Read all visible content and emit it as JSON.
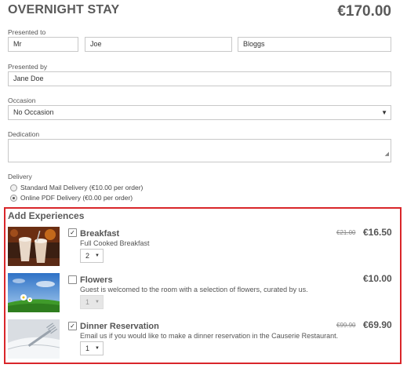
{
  "header": {
    "title": "OVERNIGHT STAY",
    "total": "€170.00"
  },
  "presented_to": {
    "label": "Presented to",
    "title_value": "Mr",
    "first_name": "Joe",
    "last_name": "Bloggs"
  },
  "presented_by": {
    "label": "Presented by",
    "value": "Jane Doe"
  },
  "occasion": {
    "label": "Occasion",
    "value": "No Occasion"
  },
  "dedication": {
    "label": "Dedication",
    "value": ""
  },
  "delivery": {
    "label": "Delivery",
    "options": [
      {
        "label": "Standard Mail Delivery (€10.00 per order)",
        "selected": false
      },
      {
        "label": "Online PDF Delivery (€0.00 per order)",
        "selected": true
      }
    ]
  },
  "experiences": {
    "title": "Add Experiences",
    "items": [
      {
        "name": "Breakfast",
        "description": "Full Cooked Breakfast",
        "old_price": "€21.00",
        "price": "€16.50",
        "checked": true,
        "qty": "2",
        "qty_disabled": false,
        "image_icon": "hot-drinks-image"
      },
      {
        "name": "Flowers",
        "description": "Guest is welcomed to the room with a selection of flowers, curated by us.",
        "old_price": "",
        "price": "€10.00",
        "checked": false,
        "qty": "1",
        "qty_disabled": true,
        "image_icon": "daisies-sky-image"
      },
      {
        "name": "Dinner Reservation",
        "description": "Email us if you would like to make a dinner reservation in the Causerie Restaurant.",
        "old_price": "€99.90",
        "price": "€69.90",
        "checked": true,
        "qty": "1",
        "qty_disabled": false,
        "image_icon": "fork-napkin-image"
      }
    ]
  },
  "colors": {
    "accent_border": "#d9262a",
    "text": "#555555"
  }
}
